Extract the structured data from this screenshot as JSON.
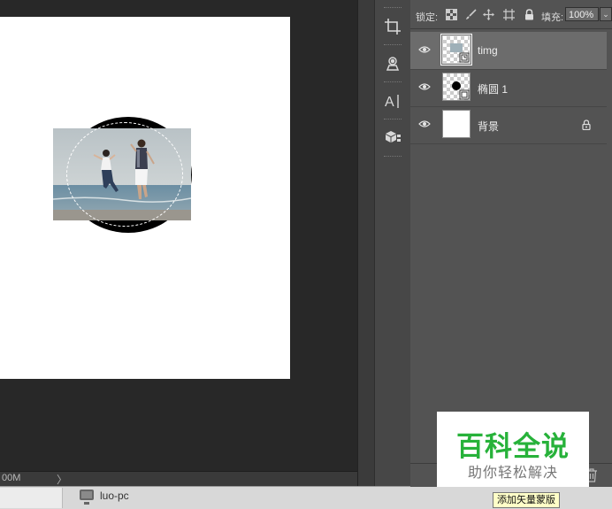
{
  "status_bar": {
    "zoom_readout": "00M",
    "menu_arrow": "〉"
  },
  "taskbar": {
    "computer_label": "luo-pc"
  },
  "layers_panel": {
    "lock_label": "锁定:",
    "fill_label": "填充:",
    "fill_value": "100%",
    "layers": [
      {
        "name": "timg",
        "visible": true,
        "selected": true,
        "thumbnail": "smart-object-photo"
      },
      {
        "name": "椭圆 1",
        "visible": true,
        "selected": false,
        "thumbnail": "ellipse-shape"
      },
      {
        "name": "背景",
        "visible": true,
        "selected": false,
        "thumbnail": "white-background",
        "locked": true
      }
    ]
  },
  "tools": [
    "crop-icon",
    "stamp-icon",
    "type-tool-icon",
    "3d-material-icon"
  ],
  "tooltip": {
    "text": "添加矢量蒙版"
  },
  "watermark": {
    "title": "百科全说",
    "subtitle": "助你轻松解决"
  },
  "colors": {
    "accent_green": "#27b23a",
    "panel_bg": "#535353",
    "selected_row": "#6c6c6c",
    "canvas_bg": "#282828"
  }
}
